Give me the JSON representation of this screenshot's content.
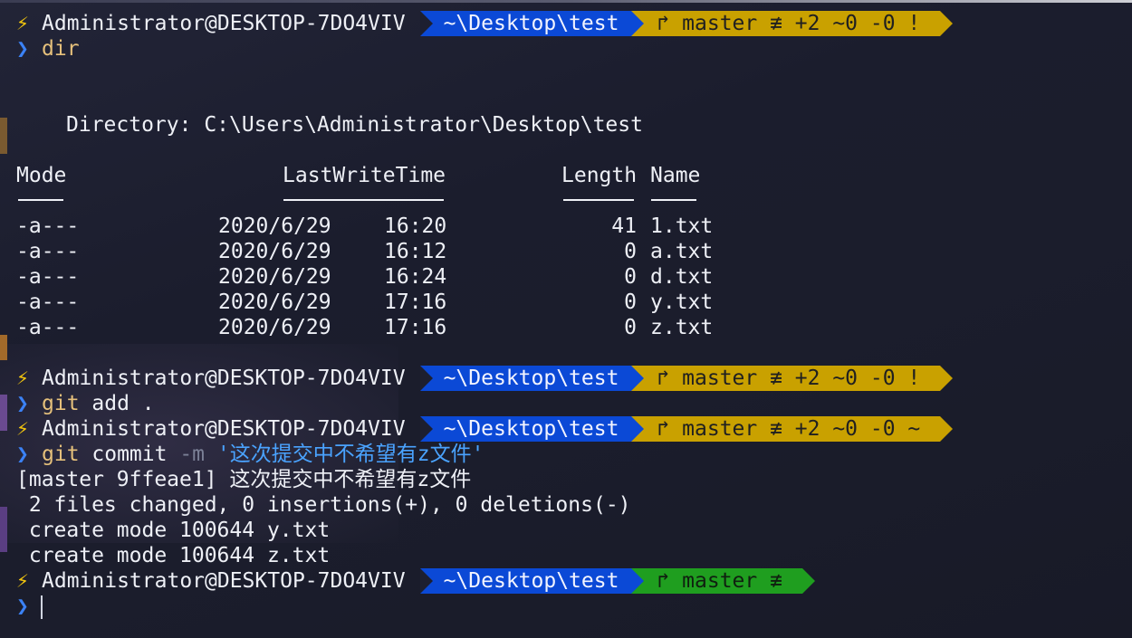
{
  "prompt": {
    "bolt": "⚡",
    "user": "Administrator@DESKTOP-7DO4VIV",
    "path": "~\\Desktop\\test"
  },
  "prompts": [
    {
      "git": "↱ master ≢ +2 ~0 -0 !",
      "status_color": "#c9a100"
    },
    {
      "git": "↱ master ≢ +2 ~0 -0 !",
      "status_color": "#c9a100"
    },
    {
      "git": "↱ master ≢ +2 ~0 -0 ~",
      "status_color": "#c9a100"
    },
    {
      "git": "↱ master ≢",
      "status_color": "#1f9e1f"
    }
  ],
  "chevron": "❯",
  "commands": {
    "dir": {
      "cmd": "dir"
    },
    "add": {
      "cmd": "git",
      "args": " add ."
    },
    "commit": {
      "cmd": "git",
      "args": " commit ",
      "flag": "-m",
      "message": "'这次提交中不希望有z文件'"
    }
  },
  "listing": {
    "directory_line": "Directory: C:\\Users\\Administrator\\Desktop\\test",
    "headers": {
      "mode": "Mode",
      "lastwritetime": "LastWriteTime",
      "length": "Length",
      "name": "Name"
    },
    "rows": [
      {
        "mode": "-a---",
        "date": "2020/6/29",
        "time": "16:20",
        "length": "41",
        "name": "1.txt"
      },
      {
        "mode": "-a---",
        "date": "2020/6/29",
        "time": "16:12",
        "length": "0",
        "name": "a.txt"
      },
      {
        "mode": "-a---",
        "date": "2020/6/29",
        "time": "16:24",
        "length": "0",
        "name": "d.txt"
      },
      {
        "mode": "-a---",
        "date": "2020/6/29",
        "time": "17:16",
        "length": "0",
        "name": "y.txt"
      },
      {
        "mode": "-a---",
        "date": "2020/6/29",
        "time": "17:16",
        "length": "0",
        "name": "z.txt"
      }
    ]
  },
  "commit_output": [
    "[master 9ffeae1] 这次提交中不希望有z文件",
    " 2 files changed, 0 insertions(+), 0 deletions(-)",
    " create mode 100644 y.txt",
    " create mode 100644 z.txt"
  ],
  "colors": {
    "background": "#1b1d2d",
    "path_segment": "#0b49d6",
    "git_dirty": "#c9a100",
    "git_clean": "#1f9e1f",
    "command": "#e5c07b",
    "string": "#4aa3ff",
    "chevron": "#3b82f6"
  }
}
